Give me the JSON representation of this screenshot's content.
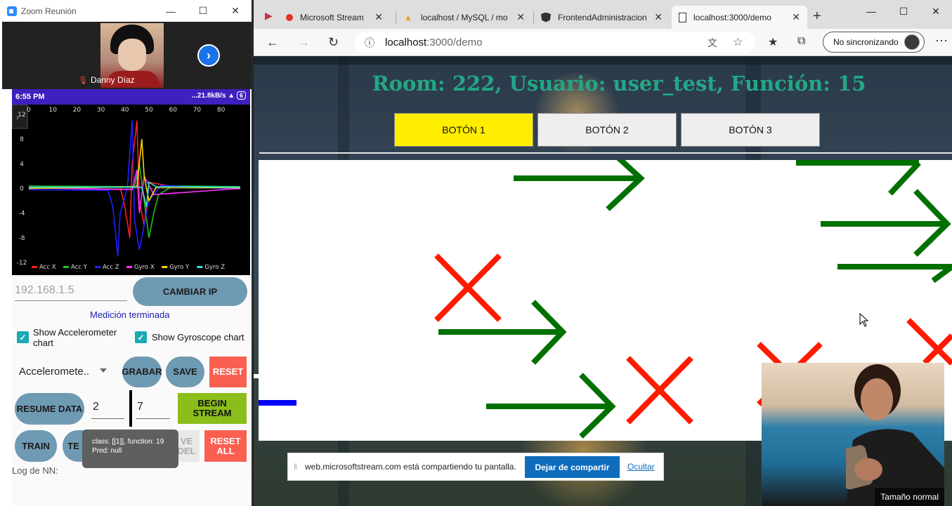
{
  "zoom": {
    "title": "Zoom Reunión",
    "participant_name": "Danny Díaz",
    "phone": {
      "time": "6:55 PM",
      "net": "...21.8kB/s",
      "battery": "6",
      "chart_data": {
        "type": "line",
        "x_ticks": [
          "0",
          "10",
          "20",
          "30",
          "40",
          "50",
          "60",
          "70",
          "80"
        ],
        "y_ticks": [
          "12",
          "8",
          "4",
          "0",
          "-4",
          "-8",
          "-12"
        ],
        "ylim": [
          -12,
          12
        ],
        "xlim": [
          0,
          88
        ],
        "legend_position": "bottom",
        "series": [
          {
            "name": "Acc X",
            "color": "#ff2020",
            "values": [
              [
                0,
                0
              ],
              [
                38,
                0.2
              ],
              [
                40,
                -3
              ],
              [
                42,
                -8
              ],
              [
                43,
                4
              ],
              [
                45,
                11
              ],
              [
                46,
                -2
              ],
              [
                48,
                -6
              ],
              [
                50,
                1
              ],
              [
                60,
                0.3
              ],
              [
                88,
                0.2
              ]
            ]
          },
          {
            "name": "Acc Y",
            "color": "#20c020",
            "values": [
              [
                0,
                0.4
              ],
              [
                44,
                0.3
              ],
              [
                46,
                4
              ],
              [
                48,
                -2
              ],
              [
                50,
                -8
              ],
              [
                52,
                -4
              ],
              [
                54,
                -1
              ],
              [
                60,
                0.4
              ],
              [
                88,
                0.3
              ]
            ]
          },
          {
            "name": "Acc Z",
            "color": "#2020ff",
            "values": [
              [
                0,
                -0.2
              ],
              [
                33,
                -0.3
              ],
              [
                35,
                -3
              ],
              [
                37,
                -11
              ],
              [
                38,
                -4
              ],
              [
                41,
                0
              ],
              [
                43,
                11
              ],
              [
                44,
                -5
              ],
              [
                46,
                -10
              ],
              [
                50,
                -2
              ],
              [
                55,
                0.5
              ],
              [
                88,
                -0.1
              ]
            ]
          },
          {
            "name": "Gyro X",
            "color": "#ff30ff",
            "values": [
              [
                0,
                0.1
              ],
              [
                43,
                -0.2
              ],
              [
                45,
                3
              ],
              [
                46,
                -4
              ],
              [
                48,
                2
              ],
              [
                52,
                -1
              ],
              [
                88,
                0
              ]
            ]
          },
          {
            "name": "Gyro Y",
            "color": "#ffd400",
            "values": [
              [
                0,
                0
              ],
              [
                45,
                0.3
              ],
              [
                47,
                8
              ],
              [
                48,
                2
              ],
              [
                50,
                -2
              ],
              [
                53,
                0.2
              ],
              [
                88,
                0.1
              ]
            ]
          },
          {
            "name": "Gyro Z",
            "color": "#30e0e0",
            "values": [
              [
                0,
                0.2
              ],
              [
                47,
                0.2
              ],
              [
                49,
                -3
              ],
              [
                50,
                1
              ],
              [
                53,
                0.3
              ],
              [
                88,
                0.2
              ]
            ]
          }
        ]
      },
      "ip_value": "192.168.1.5",
      "btn_change_ip": "CAMBIAR IP",
      "status": "Medición terminada",
      "chk_acc": "Show Accelerometer chart",
      "chk_gyro": "Show Gyroscope chart",
      "sensor": "Acceleromete..",
      "btn_record": "GRABAR",
      "btn_save": "SAVE",
      "btn_reset": "RESET",
      "btn_resume": "RESUME DATA",
      "field_1": "2",
      "field_2": "7",
      "btn_begin_stream": "BEGIN STREAM",
      "btn_train": "TRAIN",
      "btn_test_partial": "TE ON",
      "btn_save_model_partial": "VE DEL",
      "btn_reset_all": "RESET ALL",
      "log_label": "Log de NN:",
      "tooltip_line1": "class: [[1]], function: 19",
      "tooltip_line2": "Pred: null"
    }
  },
  "browser": {
    "tabs": [
      {
        "label": "Microsoft Stream"
      },
      {
        "label": "localhost / MySQL / mo"
      },
      {
        "label": "FrontendAdministracion"
      },
      {
        "label": "localhost:3000/demo"
      }
    ],
    "url_host": "localhost",
    "url_path": ":3000/demo",
    "profile_label": "No sincronizando",
    "page": {
      "title": "Room: 222, Usuario: user_test, Función: 15",
      "buttons": [
        "BOTÓN 1",
        "BOTÓN 2",
        "BOTÓN 3"
      ],
      "active_button_color": "#ffee00",
      "arrow_color": "#007000",
      "cross_color": "#ff1a00"
    },
    "share_bar": {
      "message": "web.microsoftstream.com está compartiendo tu pantalla.",
      "stop_label": "Dejar de compartir",
      "hide_label": "Ocultar"
    },
    "camera_label": "Tamaño normal"
  }
}
